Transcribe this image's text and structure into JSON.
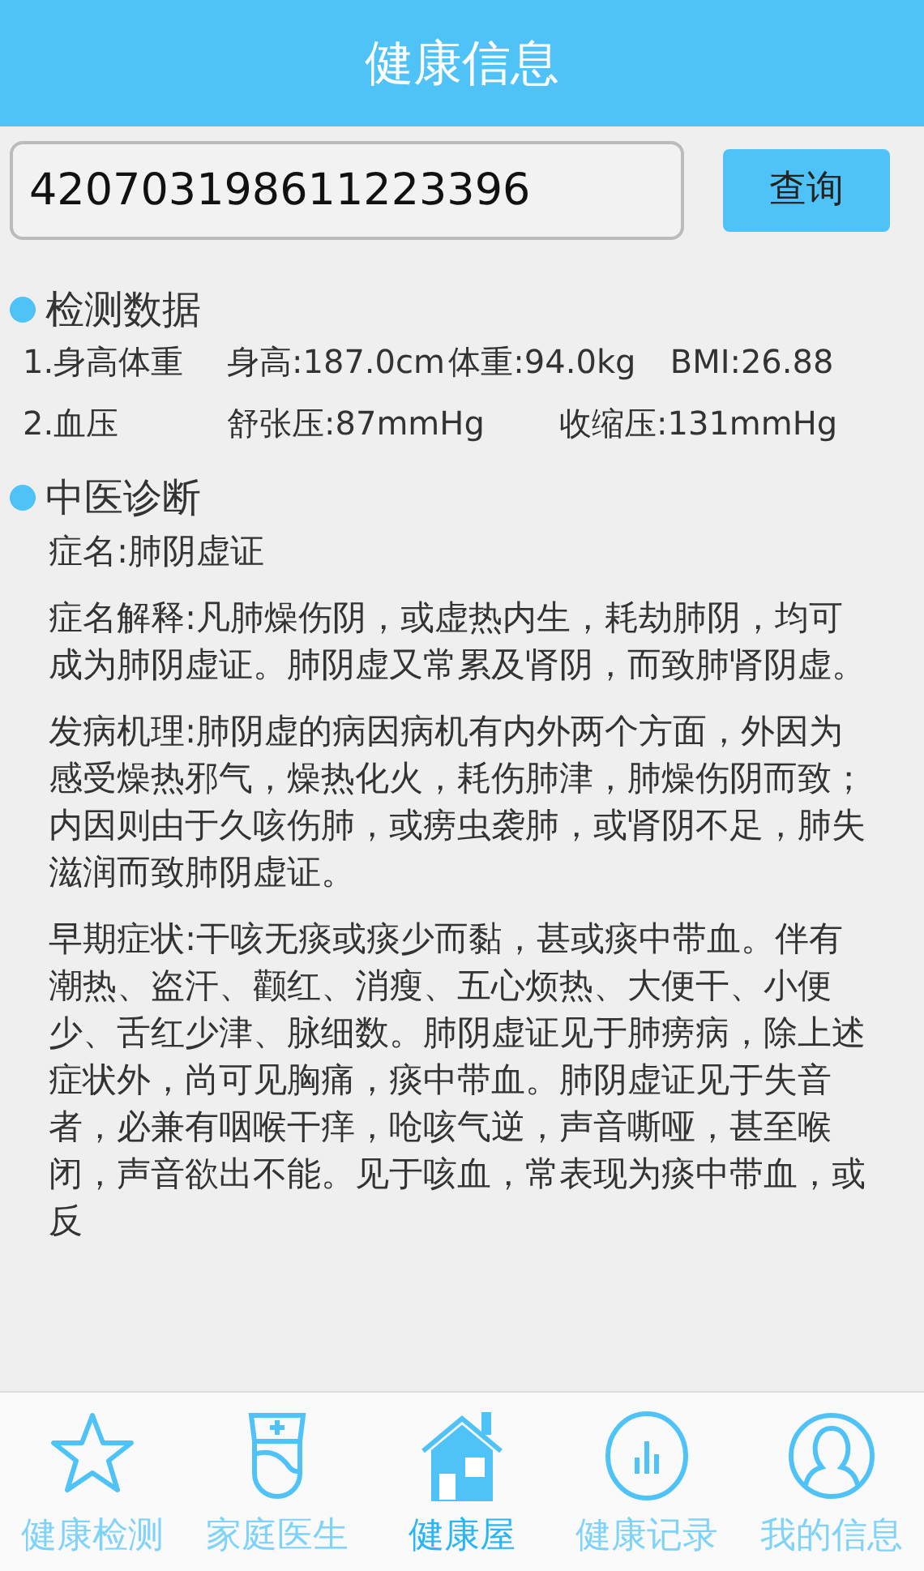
{
  "header": {
    "title": "健康信息"
  },
  "search": {
    "value": "420703198611223396",
    "button": "查询"
  },
  "sections": [
    {
      "kind": "metrics",
      "title": "检测数据",
      "rows": [
        {
          "label": "1.身高体重",
          "cells": [
            "身高:187.0cm",
            "体重:94.0kg",
            "BMI:26.88"
          ]
        },
        {
          "label": "2.血压",
          "cells": [
            "舒张压:87mmHg",
            "收缩压:131mmHg"
          ]
        }
      ]
    },
    {
      "kind": "text",
      "title": "中医诊断",
      "paragraphs": [
        "症名:肺阴虚证",
        "症名解释:凡肺燥伤阴，或虚热内生，耗劫肺阴，均可成为肺阴虚证。肺阴虚又常累及肾阴，而致肺肾阴虚。",
        "发病机理:肺阴虚的病因病机有内外两个方面，外因为感受燥热邪气，燥热化火，耗伤肺津，肺燥伤阴而致；内因则由于久咳伤肺，或痨虫袭肺，或肾阴不足，肺失滋润而致肺阴虚证。",
        "早期症状:干咳无痰或痰少而黏，甚或痰中带血。伴有潮热、盗汗、颧红、消瘦、五心烦热、大便干、小便少、舌红少津、脉细数。肺阴虚证见于肺痨病，除上述症状外，尚可见胸痛，痰中带血。肺阴虚证见于失音者，必兼有咽喉干痒，呛咳气逆，声音嘶哑，甚至喉闭，声音欲出不能。见于咳血，常表现为痰中带血，或反"
      ]
    }
  ],
  "tabs": [
    {
      "label": "健康检测",
      "selected": false
    },
    {
      "label": "家庭医生",
      "selected": false
    },
    {
      "label": "健康屋",
      "selected": true
    },
    {
      "label": "健康记录",
      "selected": false
    },
    {
      "label": "我的信息",
      "selected": false
    }
  ]
}
